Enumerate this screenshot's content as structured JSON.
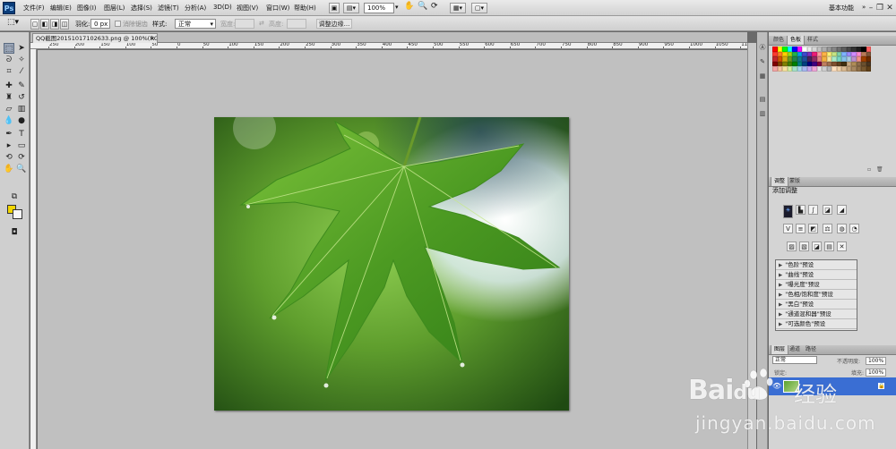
{
  "app": {
    "logo": "Ps"
  },
  "menu": {
    "items": [
      "文件(F)",
      "编辑(E)",
      "图像(I)",
      "图层(L)",
      "选择(S)",
      "滤镜(T)",
      "分析(A)",
      "3D(D)",
      "视图(V)",
      "窗口(W)",
      "帮助(H)"
    ],
    "zoom": "100%",
    "workspace": "基本功能"
  },
  "options": {
    "feather_label": "羽化:",
    "feather_value": "0 px",
    "antialias_label": "消除锯齿",
    "style_label": "样式:",
    "style_value": "正常",
    "width_label": "宽度:",
    "height_label": "高度:",
    "refine_edge_label": "调整边缘..."
  },
  "document": {
    "tab_title": "QQ截图20151017102633.png @ 100%(RGB/8)",
    "ruler_labels": [
      "250",
      "200",
      "150",
      "100",
      "50",
      "0",
      "50",
      "100",
      "150",
      "200",
      "250",
      "300",
      "350",
      "400",
      "450",
      "500",
      "550",
      "600",
      "650",
      "700",
      "750",
      "800",
      "850",
      "900",
      "950",
      "1000",
      "1050",
      "1100"
    ]
  },
  "swatches_panel": {
    "tabs": [
      "颜色",
      "色板",
      "样式"
    ],
    "active_tab": "色板",
    "colors": [
      "#ff0000",
      "#ffff00",
      "#00ff00",
      "#00ffff",
      "#0000ff",
      "#ff00ff",
      "#ffffff",
      "#ebebeb",
      "#d6d6d6",
      "#c2c2c2",
      "#adadad",
      "#999999",
      "#858585",
      "#707070",
      "#5c5c5c",
      "#474747",
      "#333333",
      "#1f1f1f",
      "#000000",
      "#ff6060",
      "#ff3b30",
      "#ff7f27",
      "#ffd100",
      "#a0d911",
      "#22b14c",
      "#00a2e8",
      "#3f48cc",
      "#7a2fbe",
      "#ed1c78",
      "#ff9aa2",
      "#ffb347",
      "#fff275",
      "#c5e384",
      "#7fd1a9",
      "#7fb3ff",
      "#9b8cff",
      "#d08cff",
      "#ff8cd0",
      "#b97a57",
      "#7f5539",
      "#c1272d",
      "#d35400",
      "#d4ac0d",
      "#6a9a1f",
      "#1e8449",
      "#117a8b",
      "#1f4e9c",
      "#4a235a",
      "#922b65",
      "#e08283",
      "#f5b041",
      "#f9e79f",
      "#abebc6",
      "#76d7c4",
      "#85c1e9",
      "#a9cce3",
      "#bb8fce",
      "#f1948a",
      "#a04000",
      "#6e2c00",
      "#800000",
      "#804000",
      "#808000",
      "#408000",
      "#008000",
      "#008080",
      "#004080",
      "#000080",
      "#400080",
      "#800040",
      "#c08060",
      "#a07050",
      "#805030",
      "#604020",
      "#403010",
      "#c8a882",
      "#b08d57",
      "#8d6e4c",
      "#6b4f2e",
      "#4a3520",
      "#f4a6a6",
      "#f7c59f",
      "#f7e39f",
      "#d6f0a0",
      "#a6e3c8",
      "#a6d8f0",
      "#a6b8f0",
      "#c7a6f0",
      "#f0a6d8",
      "#e8e8e8",
      "#cfcfcf",
      "#b5b5b5",
      "#ffe0c0",
      "#f0d0a8",
      "#d8b890",
      "#c0a078",
      "#a88860",
      "#907048",
      "#785830",
      "#604018"
    ]
  },
  "adjustments_panel": {
    "tabs": [
      "调整",
      "蒙版"
    ],
    "title": "添加调整",
    "presets": [
      "\"色阶\"预设",
      "\"曲线\"预设",
      "\"曝光度\"预设",
      "\"色相/饱和度\"预设",
      "\"黑白\"预设",
      "\"通道混和器\"预设",
      "\"可选颜色\"预设"
    ]
  },
  "layers_panel": {
    "tabs": [
      "图层",
      "通道",
      "路径"
    ],
    "blend_mode": "正常",
    "opacity_label": "不透明度:",
    "opacity_value": "100%",
    "fill_label": "填充:",
    "fill_value": "100%",
    "lock_label": "锁定:"
  },
  "watermark": {
    "text_main": "Bai",
    "text_du": "du",
    "text_cn": "经验",
    "url": "jingyan.baidu.com"
  }
}
